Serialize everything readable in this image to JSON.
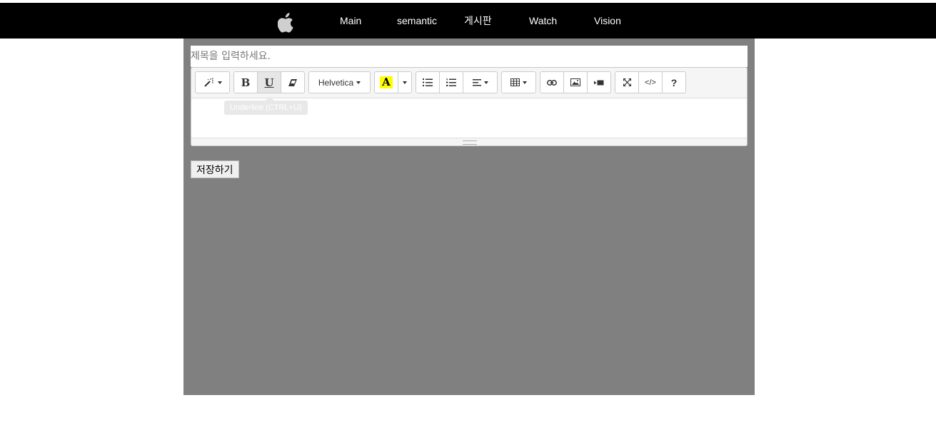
{
  "nav": {
    "logo_icon": "apple-logo",
    "items": [
      "Main",
      "semantic",
      "게시판",
      "Watch",
      "Vision"
    ]
  },
  "form": {
    "title_placeholder": "제목을 입력하세요.",
    "save_label": "저장하기"
  },
  "toolbar": {
    "style_icon": "magic-wand-icon",
    "bold_label": "B",
    "underline_label": "U",
    "eraser_icon": "eraser-icon",
    "font_name": "Helvetica",
    "color_label": "A",
    "code_label": "</>",
    "help_label": "?",
    "tooltip": "Underline (CTRL+U)",
    "active": "underline",
    "colors": {
      "highlight": "#ffff00"
    }
  },
  "colors": {
    "nav_bg": "#000000",
    "content_bg": "#808080"
  }
}
